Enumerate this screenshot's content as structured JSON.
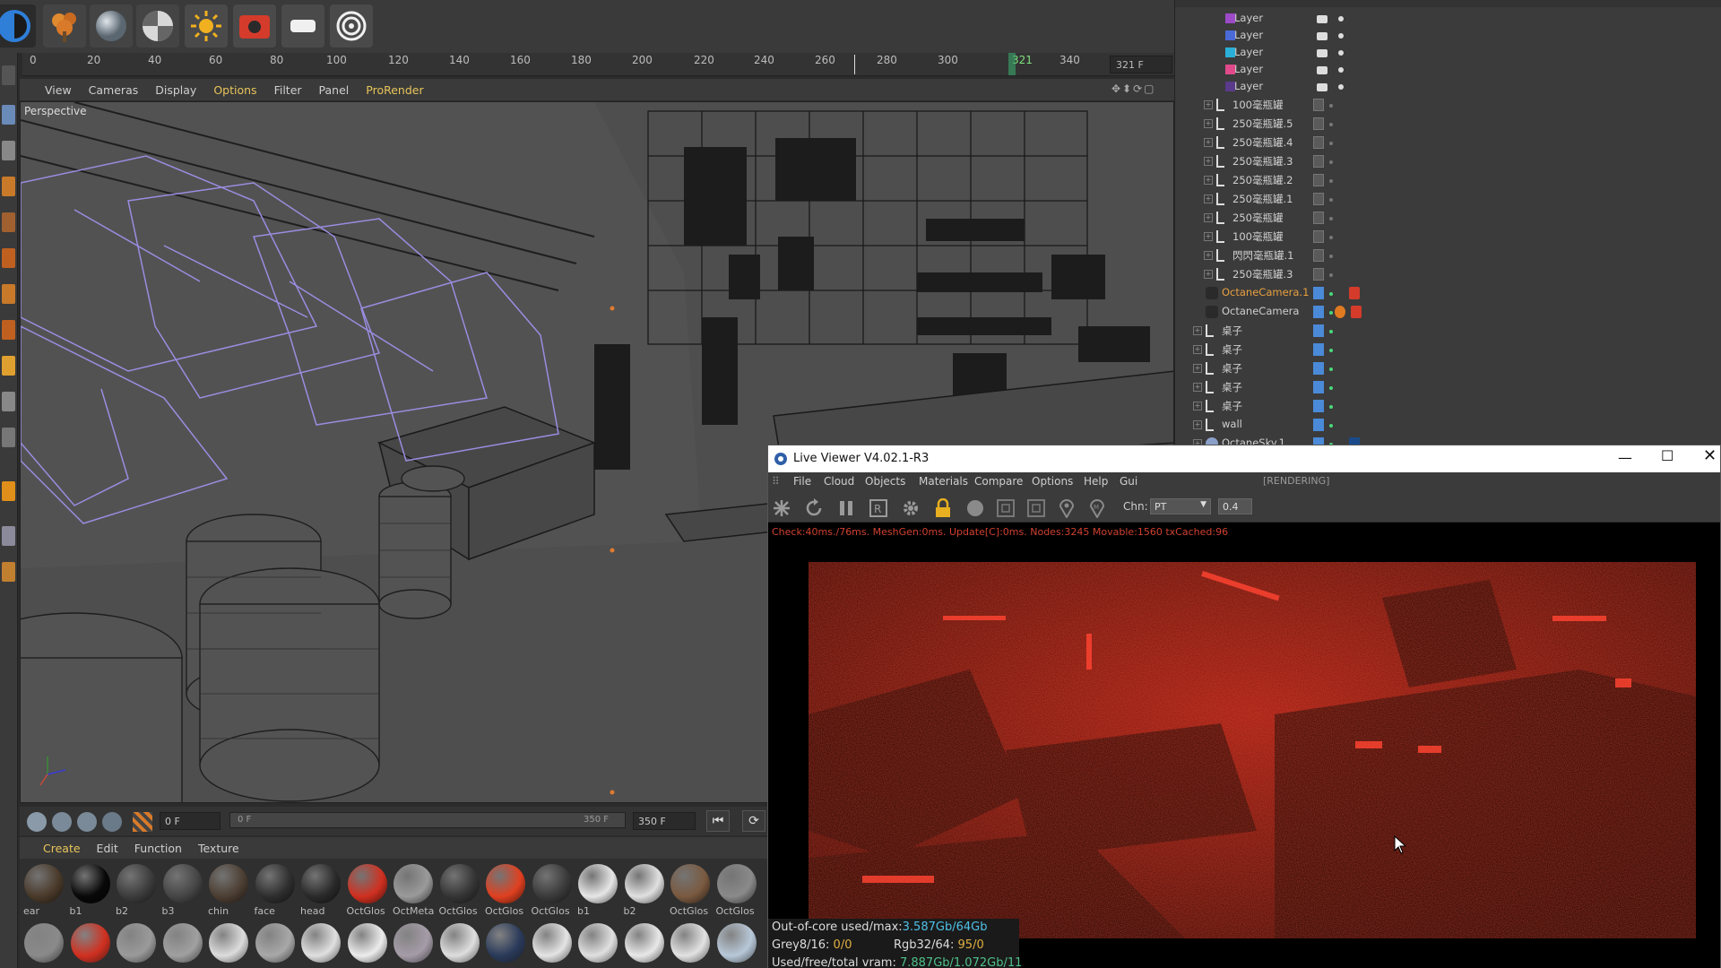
{
  "toolbar": {
    "buttons": [
      {
        "icon": "octane-logo-icon",
        "color": "#2f7fd8"
      },
      {
        "icon": "tree-explosion-icon",
        "color": "#d87a2a"
      },
      {
        "icon": "sphere-icon",
        "color": "#9aa3ad"
      },
      {
        "icon": "checker-sphere-icon",
        "color": "#c8c8c8"
      },
      {
        "icon": "sun-light-icon",
        "color": "#f0b020"
      },
      {
        "icon": "render-camera-icon",
        "color": "#d43b2b"
      },
      {
        "icon": "area-light-icon",
        "color": "#f0f0f0"
      },
      {
        "icon": "target-icon",
        "color": "#f0f0f0"
      }
    ]
  },
  "timeline": {
    "ticks": [
      "0",
      "20",
      "40",
      "60",
      "80",
      "100",
      "120",
      "140",
      "160",
      "180",
      "200",
      "220",
      "240",
      "260",
      "280",
      "300",
      "321",
      "340"
    ],
    "current_frame": "321",
    "frame_field": "321 F",
    "start_field": "0 F",
    "slider_start": "0 F",
    "slider_end": "350 F",
    "end_field": "350 F"
  },
  "viewport": {
    "menu": [
      "View",
      "Cameras",
      "Display",
      "Options",
      "Filter",
      "Panel",
      "ProRender"
    ],
    "highlight": "Options",
    "label": "Perspective"
  },
  "materials": {
    "menu": [
      "Create",
      "Edit",
      "Function",
      "Texture"
    ],
    "highlight": "Create",
    "row1": [
      {
        "label": "ear",
        "color": "#4a3a2a"
      },
      {
        "label": "b1",
        "color": "#080808"
      },
      {
        "label": "b2",
        "color": "#3c3c3c"
      },
      {
        "label": "b3",
        "color": "#454545"
      },
      {
        "label": "chin",
        "color": "#4c3e32"
      },
      {
        "label": "face",
        "color": "#2e2e2e"
      },
      {
        "label": "head",
        "color": "#2a2a2a"
      },
      {
        "label": "OctGlos",
        "color": "#d03020"
      },
      {
        "label": "OctMeta",
        "color": "#9a9a9a"
      },
      {
        "label": "OctGlos",
        "color": "#353535"
      },
      {
        "label": "OctGlos",
        "color": "#e04020"
      },
      {
        "label": "OctGlos",
        "color": "#3a3a3a"
      },
      {
        "label": "b1",
        "color": "#e6e6e6"
      },
      {
        "label": "b2",
        "color": "#e0e0e0"
      },
      {
        "label": "OctGlos",
        "color": "#7a5a40"
      },
      {
        "label": "OctGlos",
        "color": "#8a8a8a"
      }
    ],
    "row2": [
      {
        "color": "#8a8a8a"
      },
      {
        "color": "#d03020"
      },
      {
        "color": "#9a9a9a"
      },
      {
        "color": "#a0a0a0"
      },
      {
        "color": "#dcdcdc"
      },
      {
        "color": "#a8a8a8"
      },
      {
        "color": "#e0e0e0"
      },
      {
        "color": "#ececec"
      },
      {
        "color": "#a59ca8"
      },
      {
        "color": "#dedede"
      },
      {
        "color": "#2a3a5a"
      },
      {
        "color": "#e4e4e4"
      },
      {
        "color": "#e0e0e0"
      },
      {
        "color": "#e8e8e8"
      },
      {
        "color": "#e2e2e2"
      },
      {
        "color": "#b8c8d8"
      }
    ]
  },
  "objects": {
    "rows": [
      {
        "name": "Layer",
        "type": "layer",
        "swatch": "#9c4ac8"
      },
      {
        "name": "Layer",
        "type": "layer",
        "swatch": "#4a6ad8"
      },
      {
        "name": "Layer",
        "type": "layer",
        "swatch": "#2ab0d8"
      },
      {
        "name": "Layer",
        "type": "layer",
        "swatch": "#e04a8a"
      },
      {
        "name": "Layer",
        "type": "layer",
        "swatch": "#5a3a8a"
      },
      {
        "name": "100毫瓶罐",
        "type": "null"
      },
      {
        "name": "250毫瓶罐.5",
        "type": "null"
      },
      {
        "name": "250毫瓶罐.4",
        "type": "null"
      },
      {
        "name": "250毫瓶罐.3",
        "type": "null"
      },
      {
        "name": "250毫瓶罐.2",
        "type": "null"
      },
      {
        "name": "250毫瓶罐.1",
        "type": "null"
      },
      {
        "name": "250毫瓶罐",
        "type": "null"
      },
      {
        "name": "100毫瓶罐",
        "type": "null"
      },
      {
        "name": "閃閃毫瓶罐.1",
        "type": "null"
      },
      {
        "name": "250毫瓶罐.3",
        "type": "null"
      },
      {
        "name": "OctaneCamera.1",
        "type": "camera",
        "active": true
      },
      {
        "name": "OctaneCamera",
        "type": "camera"
      },
      {
        "name": "桌子",
        "type": "null2"
      },
      {
        "name": "桌子",
        "type": "null2"
      },
      {
        "name": "桌子",
        "type": "null2"
      },
      {
        "name": "桌子",
        "type": "null2"
      },
      {
        "name": "桌子",
        "type": "null2"
      },
      {
        "name": "wall",
        "type": "null2"
      },
      {
        "name": "OctaneSky.1",
        "type": "sky"
      }
    ]
  },
  "live_viewer": {
    "title": "Live Viewer V4.02.1-R3",
    "menu": [
      "File",
      "Cloud",
      "Objects",
      "Materials",
      "Compare",
      "Options",
      "Help",
      "Gui"
    ],
    "state": "[RENDERING]",
    "channel_label": "Chn:",
    "channel_value": "PT",
    "exposure_value": "0.4",
    "status": "Check:40ms./76ms. MeshGen:0ms. Update[C]:0ms. Nodes:3245 Movable:1560 txCached:96",
    "info": {
      "line1_label": "Out-of-core used/max:",
      "line1_value": "3.587Gb/64Gb",
      "line2_a_label": "Grey8/16:",
      "line2_a_value": "0/0",
      "line2_b_label": "Rgb32/64:",
      "line2_b_value": "95/0",
      "line3_label": "Used/free/total vram:",
      "line3_value": "7.887Gb/1.072Gb/11"
    }
  }
}
